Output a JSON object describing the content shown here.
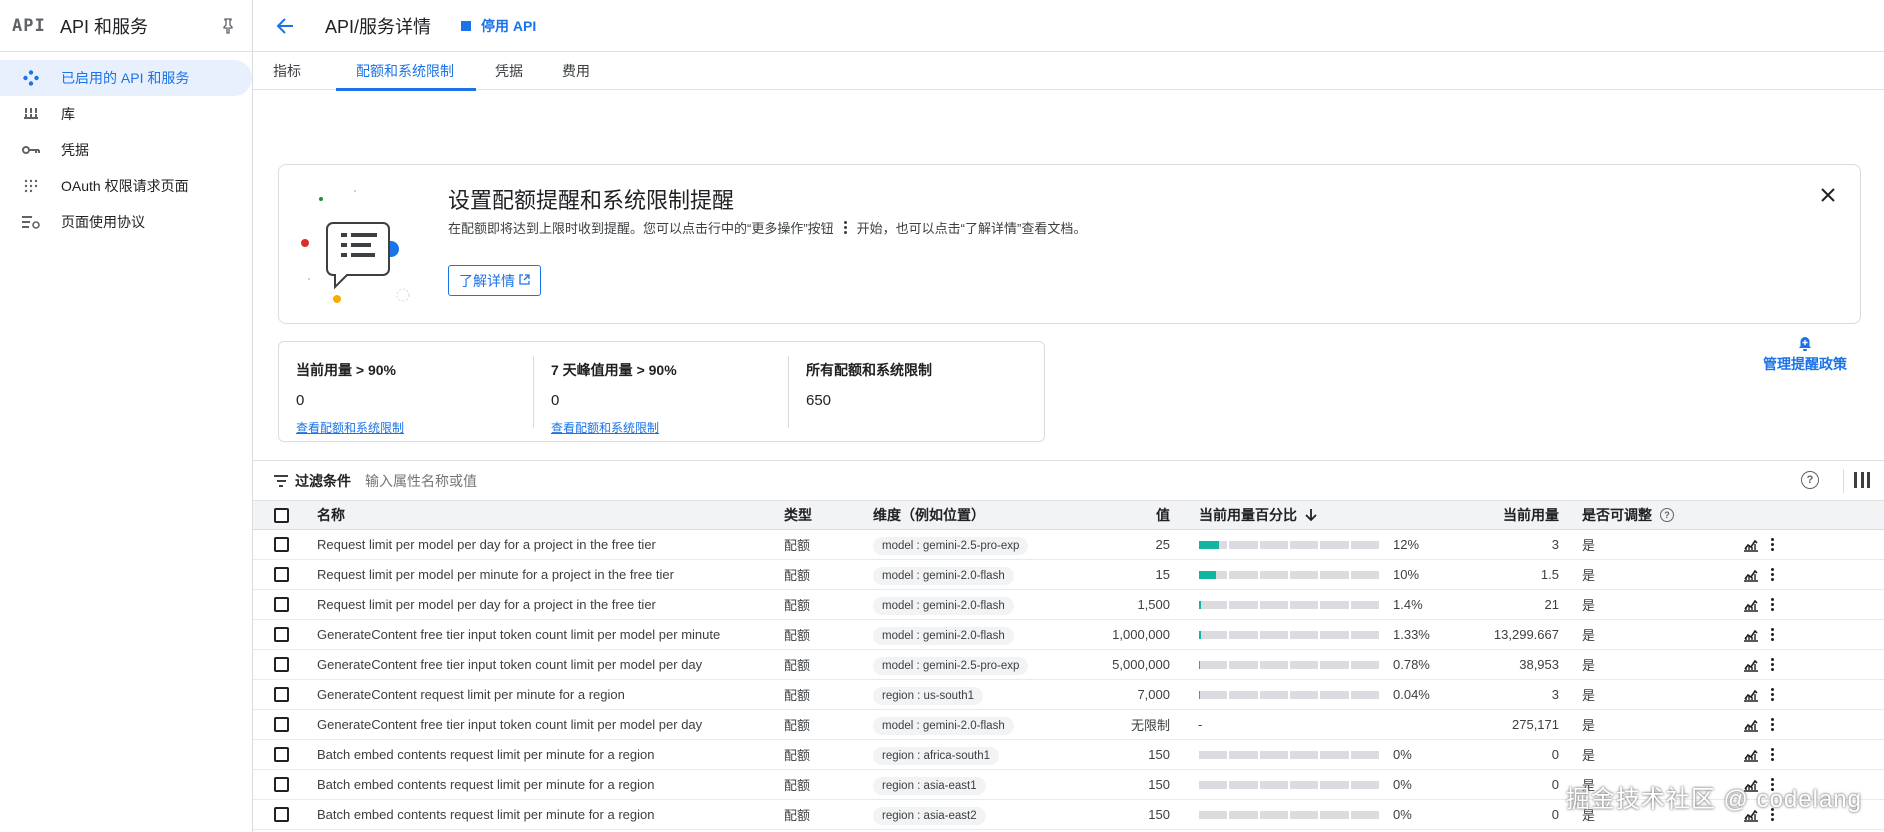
{
  "sidebar": {
    "logo": "API",
    "title": "API 和服务",
    "items": [
      {
        "label": "已启用的 API 和服务",
        "icon": "diamond-nodes-icon",
        "active": true
      },
      {
        "label": "库",
        "icon": "library-grid-icon",
        "active": false
      },
      {
        "label": "凭据",
        "icon": "key-icon",
        "active": false
      },
      {
        "label": "OAuth 权限请求页面",
        "icon": "dots-grid-icon",
        "active": false
      },
      {
        "label": "页面使用协议",
        "icon": "list-settings-icon",
        "active": false
      }
    ]
  },
  "header": {
    "title": "API/服务详情",
    "disable_label": "停用 API"
  },
  "tabs": [
    "指标",
    "配额和系统限制",
    "凭据",
    "费用"
  ],
  "banner": {
    "title": "设置配额提醒和系统限制提醒",
    "text_before": "在配额即将达到上限时收到提醒。您可以点击行中的“更多操作”按钮",
    "text_after": "开始，也可以点击“了解详情”查看文档。",
    "learn_label": "了解详情"
  },
  "summary": [
    {
      "label": "当前用量 > 90%",
      "value": "0",
      "link": "查看配额和系统限制"
    },
    {
      "label": "7 天峰值用量 > 90%",
      "value": "0",
      "link": "查看配额和系统限制"
    },
    {
      "label": "所有配额和系统限制",
      "value": "650",
      "link": ""
    }
  ],
  "manage_label": "管理提醒政策",
  "filter": {
    "label": "过滤条件",
    "placeholder": "输入属性名称或值"
  },
  "table": {
    "headers": {
      "name": "名称",
      "type": "类型",
      "dimension": "维度（例如位置）",
      "value": "值",
      "pct": "当前用量百分比",
      "usage": "当前用量",
      "adjustable": "是否可调整"
    },
    "rows": [
      {
        "name": "Request limit per model per day for a project in the free tier",
        "type": "配额",
        "dim": "model : gemini-2.5-pro-exp",
        "value": "25",
        "pct": 12,
        "pct_text": "12%",
        "usage": "3",
        "adj": "是"
      },
      {
        "name": "Request limit per model per minute for a project in the free tier",
        "type": "配额",
        "dim": "model : gemini-2.0-flash",
        "value": "15",
        "pct": 10,
        "pct_text": "10%",
        "usage": "1.5",
        "adj": "是"
      },
      {
        "name": "Request limit per model per day for a project in the free tier",
        "type": "配额",
        "dim": "model : gemini-2.0-flash",
        "value": "1,500",
        "pct": 1.4,
        "pct_text": "1.4%",
        "usage": "21",
        "adj": "是"
      },
      {
        "name": "GenerateContent free tier input token count limit per model per minute",
        "type": "配额",
        "dim": "model : gemini-2.0-flash",
        "value": "1,000,000",
        "pct": 1.33,
        "pct_text": "1.33%",
        "usage": "13,299.667",
        "adj": "是"
      },
      {
        "name": "GenerateContent free tier input token count limit per model per day",
        "type": "配额",
        "dim": "model : gemini-2.5-pro-exp",
        "value": "5,000,000",
        "pct": 0.78,
        "pct_text": "0.78%",
        "usage": "38,953",
        "adj": "是"
      },
      {
        "name": "GenerateContent request limit per minute for a region",
        "type": "配额",
        "dim": "region : us-south1",
        "value": "7,000",
        "pct": 0.04,
        "pct_text": "0.04%",
        "usage": "3",
        "adj": "是"
      },
      {
        "name": "GenerateContent free tier input token count limit per model per day",
        "type": "配额",
        "dim": "model : gemini-2.0-flash",
        "value": "无限制",
        "pct": null,
        "pct_text": "-",
        "usage": "275,171",
        "adj": "是"
      },
      {
        "name": "Batch embed contents request limit per minute for a region",
        "type": "配额",
        "dim": "region : africa-south1",
        "value": "150",
        "pct": 0,
        "pct_text": "0%",
        "usage": "0",
        "adj": "是"
      },
      {
        "name": "Batch embed contents request limit per minute for a region",
        "type": "配额",
        "dim": "region : asia-east1",
        "value": "150",
        "pct": 0,
        "pct_text": "0%",
        "usage": "0",
        "adj": "是"
      },
      {
        "name": "Batch embed contents request limit per minute for a region",
        "type": "配额",
        "dim": "region : asia-east2",
        "value": "150",
        "pct": 0,
        "pct_text": "0%",
        "usage": "0",
        "adj": "是"
      }
    ]
  },
  "watermark": "掘金技术社区 @ codelang",
  "colors": {
    "accent": "#1a73e8",
    "bar_fill": "#12b5a0",
    "bar_track": "#dadce0"
  }
}
